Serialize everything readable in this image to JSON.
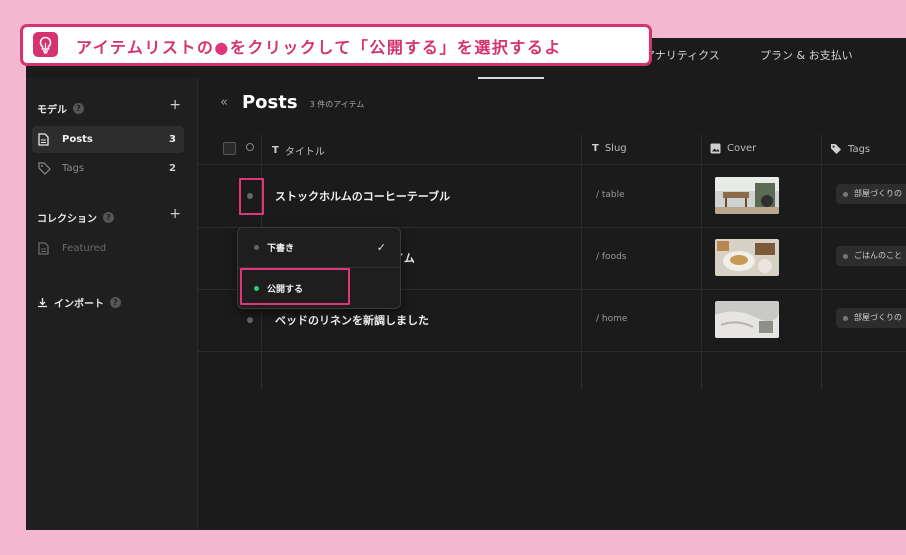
{
  "callout": {
    "text_before": "アイテムリストの",
    "dot": "●",
    "text_after": "をクリックして「公開する」を選択するよ"
  },
  "topnav": {
    "items": [
      "アナリティクス",
      "プラン & お支払い"
    ]
  },
  "sidebar": {
    "models_header": "モデル",
    "items": [
      {
        "label": "Posts",
        "count": "3"
      },
      {
        "label": "Tags",
        "count": "2"
      }
    ],
    "collections_header": "コレクション",
    "collections": [
      {
        "label": "Featured"
      }
    ],
    "import_label": "インポート"
  },
  "main": {
    "title": "Posts",
    "item_count": "3 件のアイテム",
    "collapse_icon": "«"
  },
  "table": {
    "columns": [
      {
        "icon": "T",
        "label": "タイトル"
      },
      {
        "icon": "T",
        "label": "Slug"
      },
      {
        "icon": "image-icon",
        "label": "Cover"
      },
      {
        "icon": "tag-icon",
        "label": "Tags"
      }
    ],
    "rows": [
      {
        "title": "ストックホルムのコーヒーテーブル",
        "slug": "/ table",
        "tag": "部屋づくりの"
      },
      {
        "title": "イム",
        "slug": "/ foods",
        "tag": "ごはんのこと"
      },
      {
        "title": "ベッドのリネンを新調しました",
        "slug": "/ home",
        "tag": "部屋づくりの"
      }
    ]
  },
  "dropdown": {
    "options": [
      {
        "label": "下書き",
        "selected": true,
        "color": "#666666"
      },
      {
        "label": "公開する",
        "selected": false,
        "color": "#2ecc71"
      }
    ]
  },
  "colors": {
    "accent": "#d4336f",
    "background": "#1b1b1b",
    "published": "#2ecc71"
  }
}
